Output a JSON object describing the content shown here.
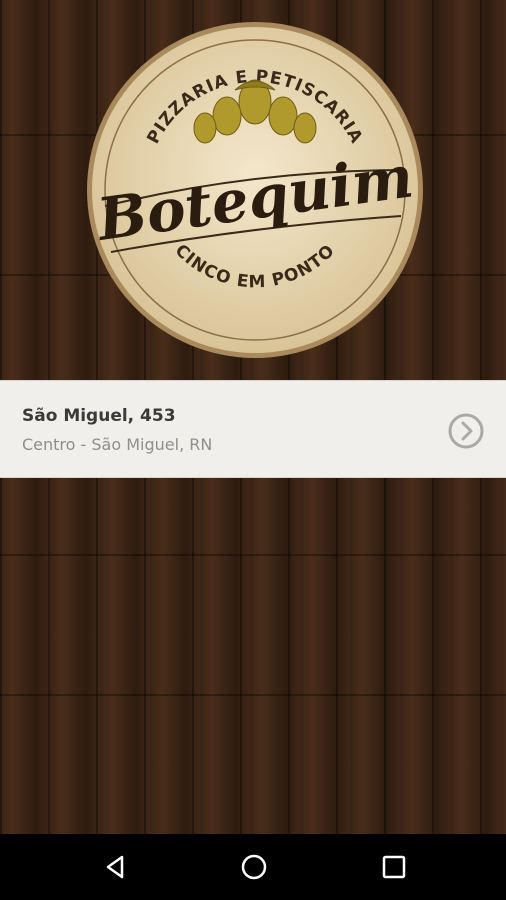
{
  "logo": {
    "arc_top_text": "PIZZARIA E PETISCARIA",
    "brand_name": "Botequim",
    "arc_bottom_text": "CINCO EM PONTO"
  },
  "location": {
    "title": "São Miguel, 453",
    "subtitle": "Centro - São Miguel, RN"
  },
  "icons": {
    "chevron": "chevron-right-circle-icon",
    "back": "back-triangle-icon",
    "home": "home-circle-icon",
    "recents": "recents-square-icon"
  },
  "colors": {
    "card_bg": "#f0efeb",
    "logo_bg": "#ecdcb9",
    "hops": "#b09a2c",
    "text_dark": "#3a3a3a",
    "text_muted": "#8f8f8f"
  }
}
